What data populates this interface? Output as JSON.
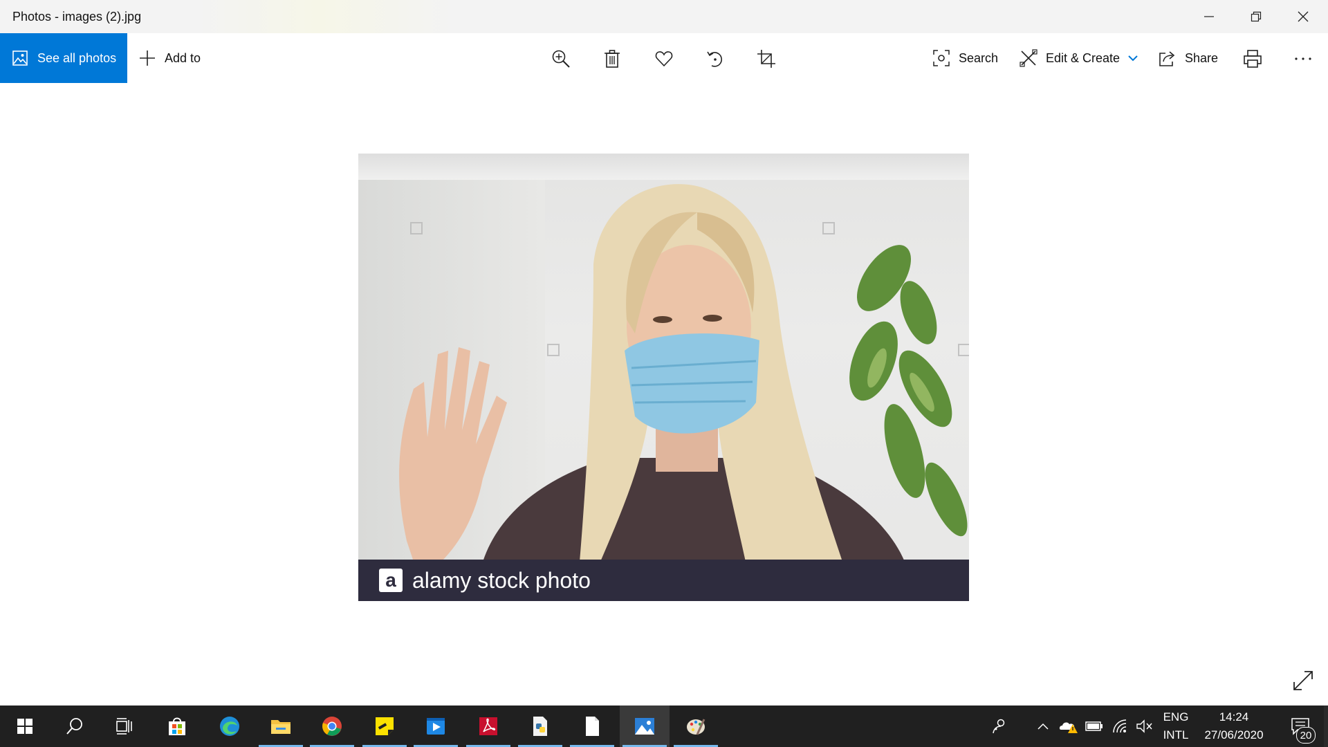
{
  "window": {
    "title": "Photos - images (2).jpg"
  },
  "toolbar": {
    "see_all_label": "See all photos",
    "add_to_label": "Add to",
    "search_label": "Search",
    "edit_create_label": "Edit & Create",
    "share_label": "Share"
  },
  "photo": {
    "watermark_logo": "a",
    "watermark_text": "alamy stock photo"
  },
  "taskbar": {
    "language": "ENG",
    "layout": "INTL",
    "time": "14:24",
    "date": "27/06/2020",
    "notifications_count": "20"
  },
  "colors": {
    "accent": "#0078d7",
    "taskbar": "#202020",
    "running_underline": "#76b9ed"
  }
}
